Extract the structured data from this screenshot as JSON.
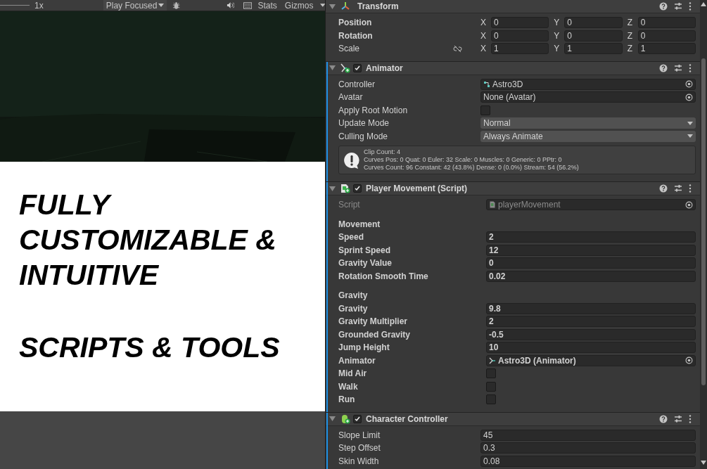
{
  "toolbar": {
    "scale_label": "1x",
    "play_mode": "Play Focused",
    "stats": "Stats",
    "gizmos": "Gizmos"
  },
  "overlay": {
    "headline": [
      "FULLY",
      "CUSTOMIZABLE &",
      "INTUITIVE"
    ],
    "subline": "SCRIPTS & TOOLS"
  },
  "components": [
    {
      "kind": "transform",
      "title": "Transform",
      "rows": [
        {
          "kind": "vector3",
          "label": "Position",
          "overridden": true,
          "axes": [
            "X",
            "Y",
            "Z"
          ],
          "values": [
            "0",
            "0",
            "0"
          ]
        },
        {
          "kind": "vector3",
          "label": "Rotation",
          "overridden": true,
          "axes": [
            "X",
            "Y",
            "Z"
          ],
          "values": [
            "0",
            "0",
            "0"
          ]
        },
        {
          "kind": "vector3",
          "label": "Scale",
          "overridden": false,
          "proportional": false,
          "axes": [
            "X",
            "Y",
            "Z"
          ],
          "values": [
            "1",
            "1",
            "1"
          ]
        }
      ]
    },
    {
      "kind": "animator",
      "title": "Animator",
      "enabled": true,
      "added": true,
      "rows": [
        {
          "kind": "controller_ref",
          "label": "Controller",
          "overridden": false,
          "value": "Astro3D"
        },
        {
          "kind": "object",
          "label": "Avatar",
          "overridden": false,
          "value": "None (Avatar)"
        },
        {
          "kind": "checkbox",
          "label": "Apply Root Motion",
          "overridden": false,
          "checked": false
        },
        {
          "kind": "dropdown",
          "label": "Update Mode",
          "overridden": false,
          "value": "Normal"
        },
        {
          "kind": "dropdown",
          "label": "Culling Mode",
          "overridden": false,
          "value": "Always Animate"
        },
        {
          "kind": "info",
          "lines": [
            "Clip Count: 4",
            "Curves Pos: 0 Quat: 0 Euler: 32 Scale: 0 Muscles: 0 Generic: 0 PPtr: 0",
            "Curves Count: 96 Constant: 42 (43.8%) Dense: 0 (0.0%) Stream: 54 (56.2%)"
          ]
        }
      ]
    },
    {
      "kind": "script",
      "title": "Player Movement (Script)",
      "enabled": true,
      "added": true,
      "rows": [
        {
          "kind": "script_ref",
          "label": "Script",
          "overridden": false,
          "disabled": true,
          "value": "playerMovement"
        },
        {
          "kind": "section",
          "label": "Movement"
        },
        {
          "kind": "field",
          "label": "Speed",
          "overridden": true,
          "value": "2"
        },
        {
          "kind": "field",
          "label": "Sprint Speed",
          "overridden": true,
          "value": "12"
        },
        {
          "kind": "field",
          "label": "Gravity Value",
          "overridden": true,
          "value": "0"
        },
        {
          "kind": "field",
          "label": "Rotation Smooth Time",
          "overridden": true,
          "value": "0.02"
        },
        {
          "kind": "section",
          "label": "Gravity"
        },
        {
          "kind": "field",
          "label": "Gravity",
          "overridden": true,
          "value": "9.8"
        },
        {
          "kind": "field",
          "label": "Gravity Multiplier",
          "overridden": true,
          "value": "2"
        },
        {
          "kind": "field",
          "label": "Grounded Gravity",
          "overridden": true,
          "value": "-0.5"
        },
        {
          "kind": "field",
          "label": "Jump Height",
          "overridden": true,
          "value": "10"
        },
        {
          "kind": "animator_ref",
          "label": "Animator",
          "overridden": true,
          "value": "Astro3D (Animator)"
        },
        {
          "kind": "checkbox",
          "label": "Mid Air",
          "overridden": true,
          "checked": false
        },
        {
          "kind": "checkbox",
          "label": "Walk",
          "overridden": true,
          "checked": false
        },
        {
          "kind": "checkbox",
          "label": "Run",
          "overridden": true,
          "checked": false
        }
      ]
    },
    {
      "kind": "character_controller",
      "title": "Character Controller",
      "enabled": true,
      "added": true,
      "rows": [
        {
          "kind": "field",
          "label": "Slope Limit",
          "overridden": false,
          "value": "45"
        },
        {
          "kind": "field",
          "label": "Step Offset",
          "overridden": false,
          "value": "0.3"
        },
        {
          "kind": "field",
          "label": "Skin Width",
          "overridden": false,
          "value": "0.08"
        }
      ]
    }
  ]
}
